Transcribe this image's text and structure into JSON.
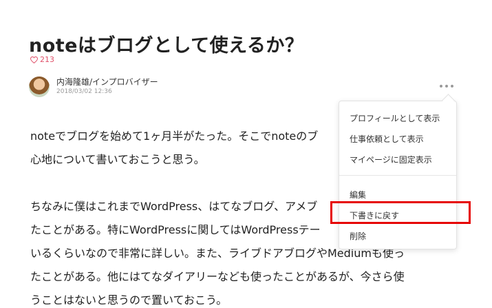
{
  "article": {
    "title": "noteはブログとして使えるか？",
    "likes": "213",
    "author_name": "内海隆雄/インプロバイザー",
    "date": "2018/03/02 12:36",
    "paragraphs": [
      "noteでブログを始めて1ヶ月半がたった。そこでnoteのブ",
      "心地について書いておこうと思う。",
      "",
      "ちなみに僕はこれまでWordPress、はてなブログ、アメブ",
      "たことがある。特にWordPressに関してはWordPressテー",
      "いるくらいなので非常に詳しい。また、ライブドアブログやMediumも使っ",
      "たことがある。他にはてなダイアリーなども使ったことがあるが、今さら使",
      "うことはないと思うので置いておこう。"
    ]
  },
  "menu": {
    "items": [
      "プロフィールとして表示",
      "仕事依頼として表示",
      "マイページに固定表示",
      "編集",
      "下書きに戻す",
      "削除"
    ]
  },
  "colors": {
    "accent_like": "#e0516a",
    "highlight": "#e60000"
  },
  "icons": {
    "like": "heart-icon",
    "more": "more-horizontal-icon"
  }
}
